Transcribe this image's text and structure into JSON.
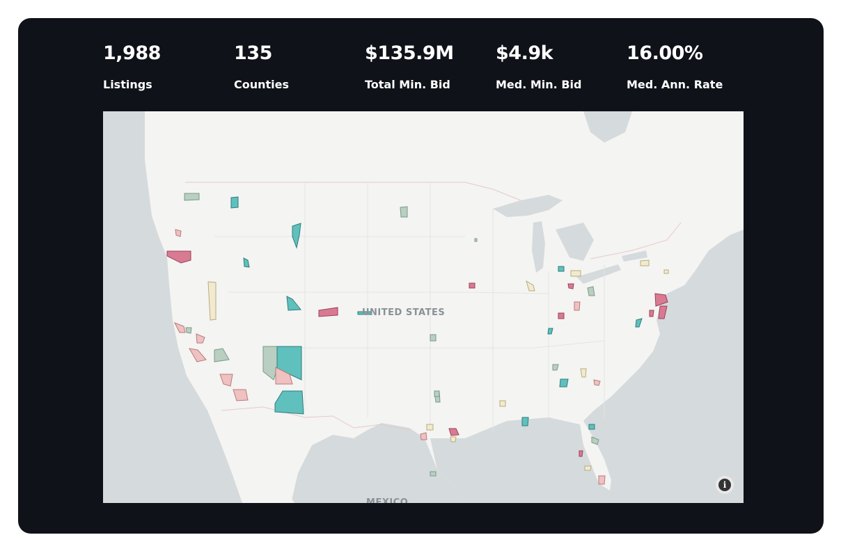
{
  "metrics": [
    {
      "value": "1,988",
      "label": "Listings"
    },
    {
      "value": "135",
      "label": "Counties"
    },
    {
      "value": "$135.9M",
      "label": "Total Min. Bid"
    },
    {
      "value": "$4.9k",
      "label": "Med. Min. Bid"
    },
    {
      "value": "16.00%",
      "label": "Med. Ann. Rate"
    }
  ],
  "map": {
    "country_label": "UNITED STATES",
    "neighbor_label": "MEXICO",
    "info_icon": "info-icon",
    "colors": {
      "land": "#f4f4f2",
      "water": "#d5dadd",
      "teal": "#5fc0bd",
      "pink": "#d97a93",
      "sage": "#b9cfc1",
      "cream": "#f1ead0",
      "rose": "#efc1c1"
    }
  }
}
